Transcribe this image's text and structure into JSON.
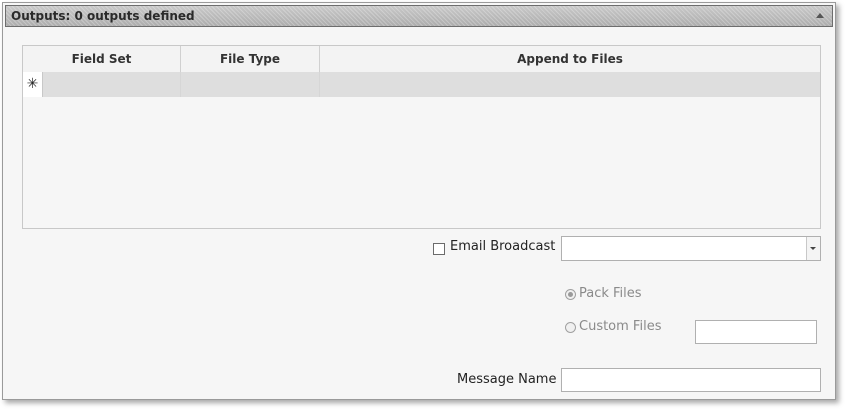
{
  "section": {
    "title": "Outputs: 0 outputs defined"
  },
  "grid": {
    "columns": [
      "Field Set",
      "File Type",
      "Append to Files"
    ],
    "new_row_marker": "✳"
  },
  "email_broadcast": {
    "label": "Email Broadcast",
    "checked": false,
    "combo_value": ""
  },
  "options": {
    "pack_files_label": "Pack Files",
    "custom_files_label": "Custom Files",
    "selected": "Pack Files",
    "custom_files_value": ""
  },
  "message_name": {
    "label": "Message Name",
    "value": ""
  }
}
